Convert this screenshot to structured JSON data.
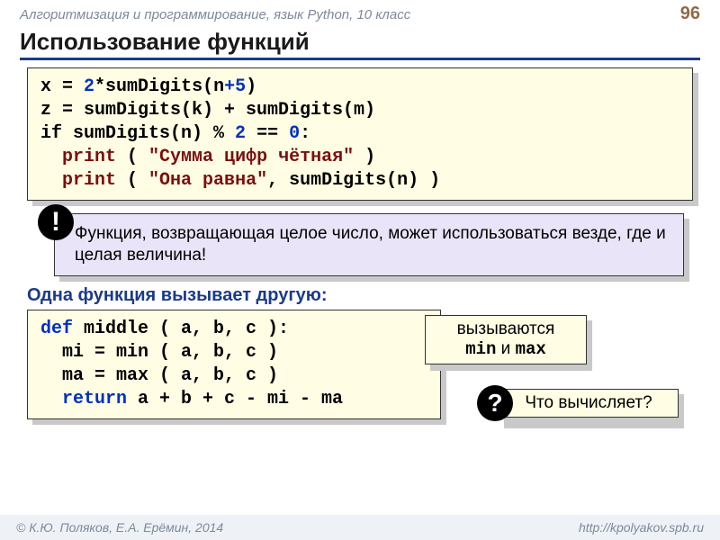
{
  "header": {
    "course": "Алгоритмизация и программирование, язык Python, 10 класс",
    "page": "96"
  },
  "title": "Использование функций",
  "code1": {
    "l1_pre": "x ",
    "l1_eq": "= ",
    "l1_num2": "2",
    "l1_mid": "*sumDigits(n",
    "l1_plus": "+",
    "l1_five": "5",
    "l1_end": ")",
    "l2": "z = sumDigits(k) + sumDigits(m)",
    "l3_pre": "if sumDigits(n)",
    "l3_pct": " % ",
    "l3_two": "2",
    "l3_eqeq": " == ",
    "l3_zero": "0",
    "l3_colon": ":",
    "l4_print": "print",
    "l4_rest": " ( ",
    "l4_str": "\"Сумма цифр чётная\"",
    "l4_close": " )",
    "l5_print": "print",
    "l5_rest": " ( ",
    "l5_str": "\"Она равна\"",
    "l5_after": ", sumDigits(n) )"
  },
  "tip": {
    "bang": "!",
    "text": "Функция, возвращающая целое число, может использоваться везде, где и целая величина!"
  },
  "subhead": "Одна функция вызывает другую:",
  "code2": {
    "l1_def": "def",
    "l1_rest": " middle ( a, b, c ):",
    "l2": "  mi = min ( a, b, c )",
    "l3": "  ma = max ( a, b, c )",
    "l4_ret": "  return",
    "l4_rest": " a + b + c - mi - ma"
  },
  "callout1": {
    "line1": "вызываются",
    "line2a": "min",
    "line2_and": " и ",
    "line2b": "max"
  },
  "callout2": {
    "q": "?",
    "text": "Что вычисляет?"
  },
  "footer": {
    "left": "© К.Ю. Поляков, Е.А. Ерёмин, 2014",
    "right": "http://kpolyakov.spb.ru"
  }
}
